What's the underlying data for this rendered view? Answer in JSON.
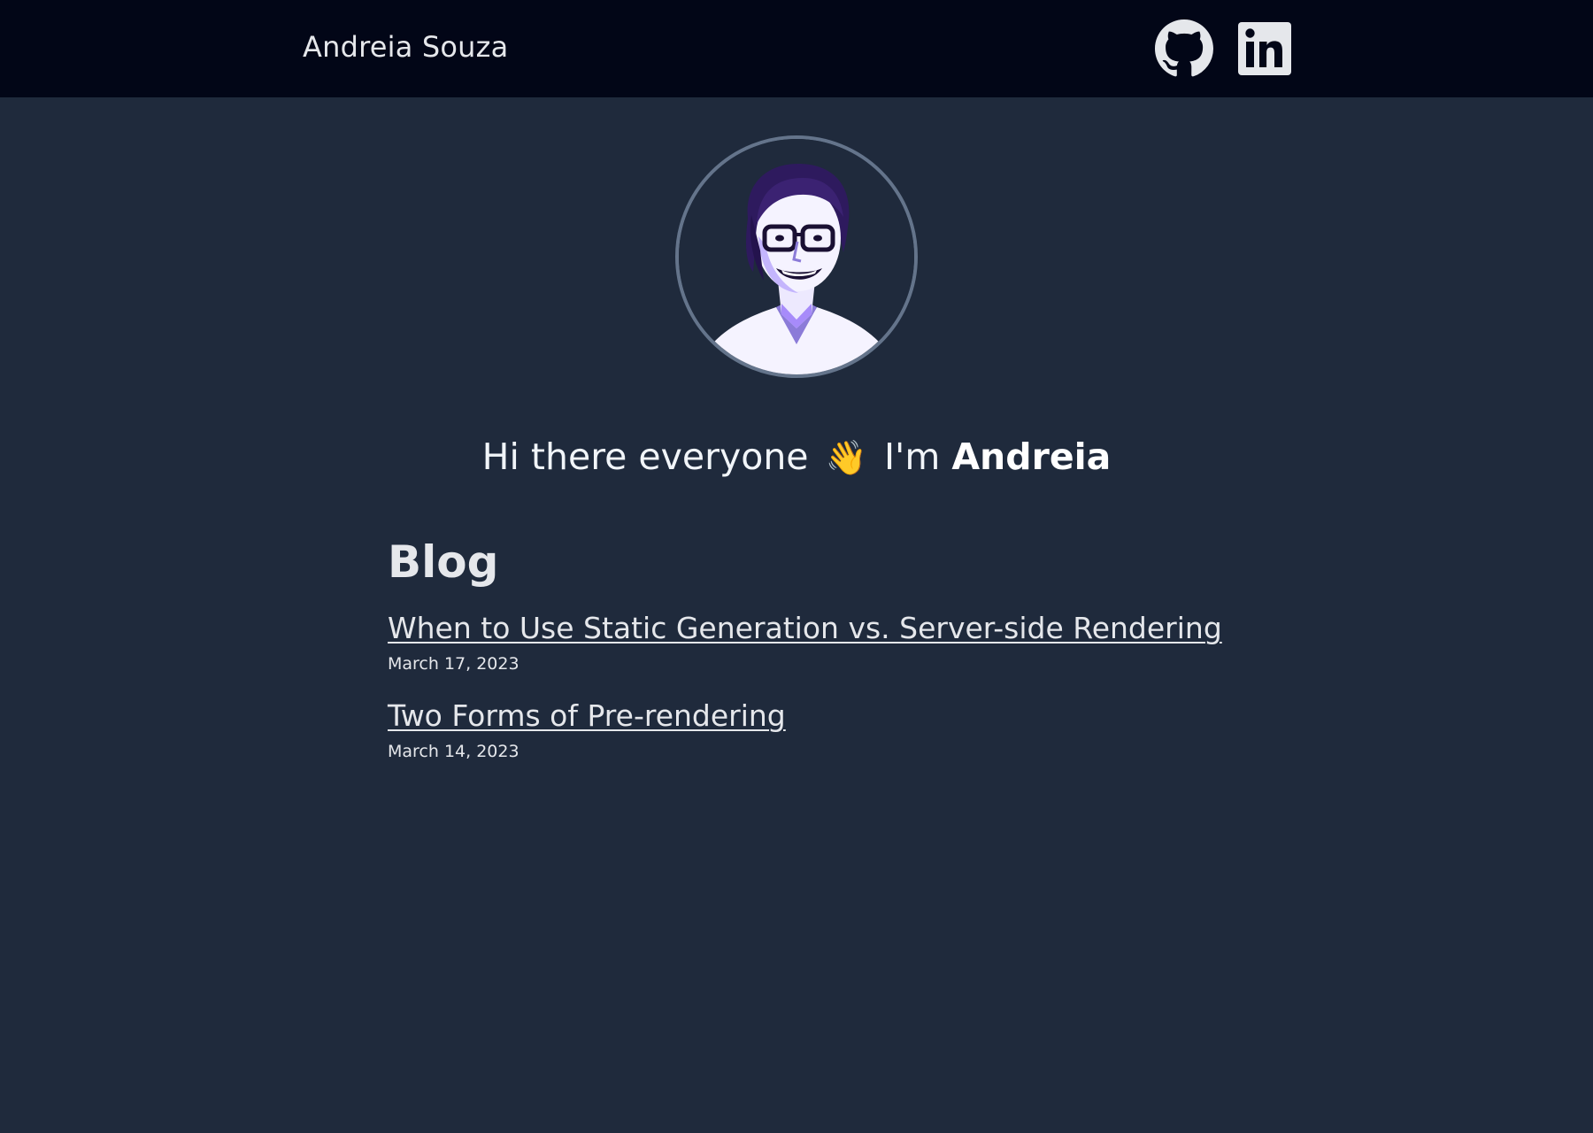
{
  "header": {
    "site_name": "Andreia Souza",
    "icons": [
      "github-icon",
      "linkedin-icon"
    ]
  },
  "hero": {
    "avatar": "profile-portrait",
    "greeting_prefix": "Hi there everyone",
    "wave_emoji": "👋",
    "greeting_mid": "I'm",
    "greeting_name": "Andreia"
  },
  "blog": {
    "title": "Blog",
    "posts": [
      {
        "title": "When to Use Static Generation vs. Server-side Rendering",
        "date": "March 17, 2023"
      },
      {
        "title": "Two Forms of Pre-rendering",
        "date": "March 14, 2023"
      }
    ]
  },
  "colors": {
    "page_bg": "#1f2a3c",
    "header_bg": "#020617",
    "text": "#e5e7eb",
    "avatar_border": "#64748b"
  }
}
